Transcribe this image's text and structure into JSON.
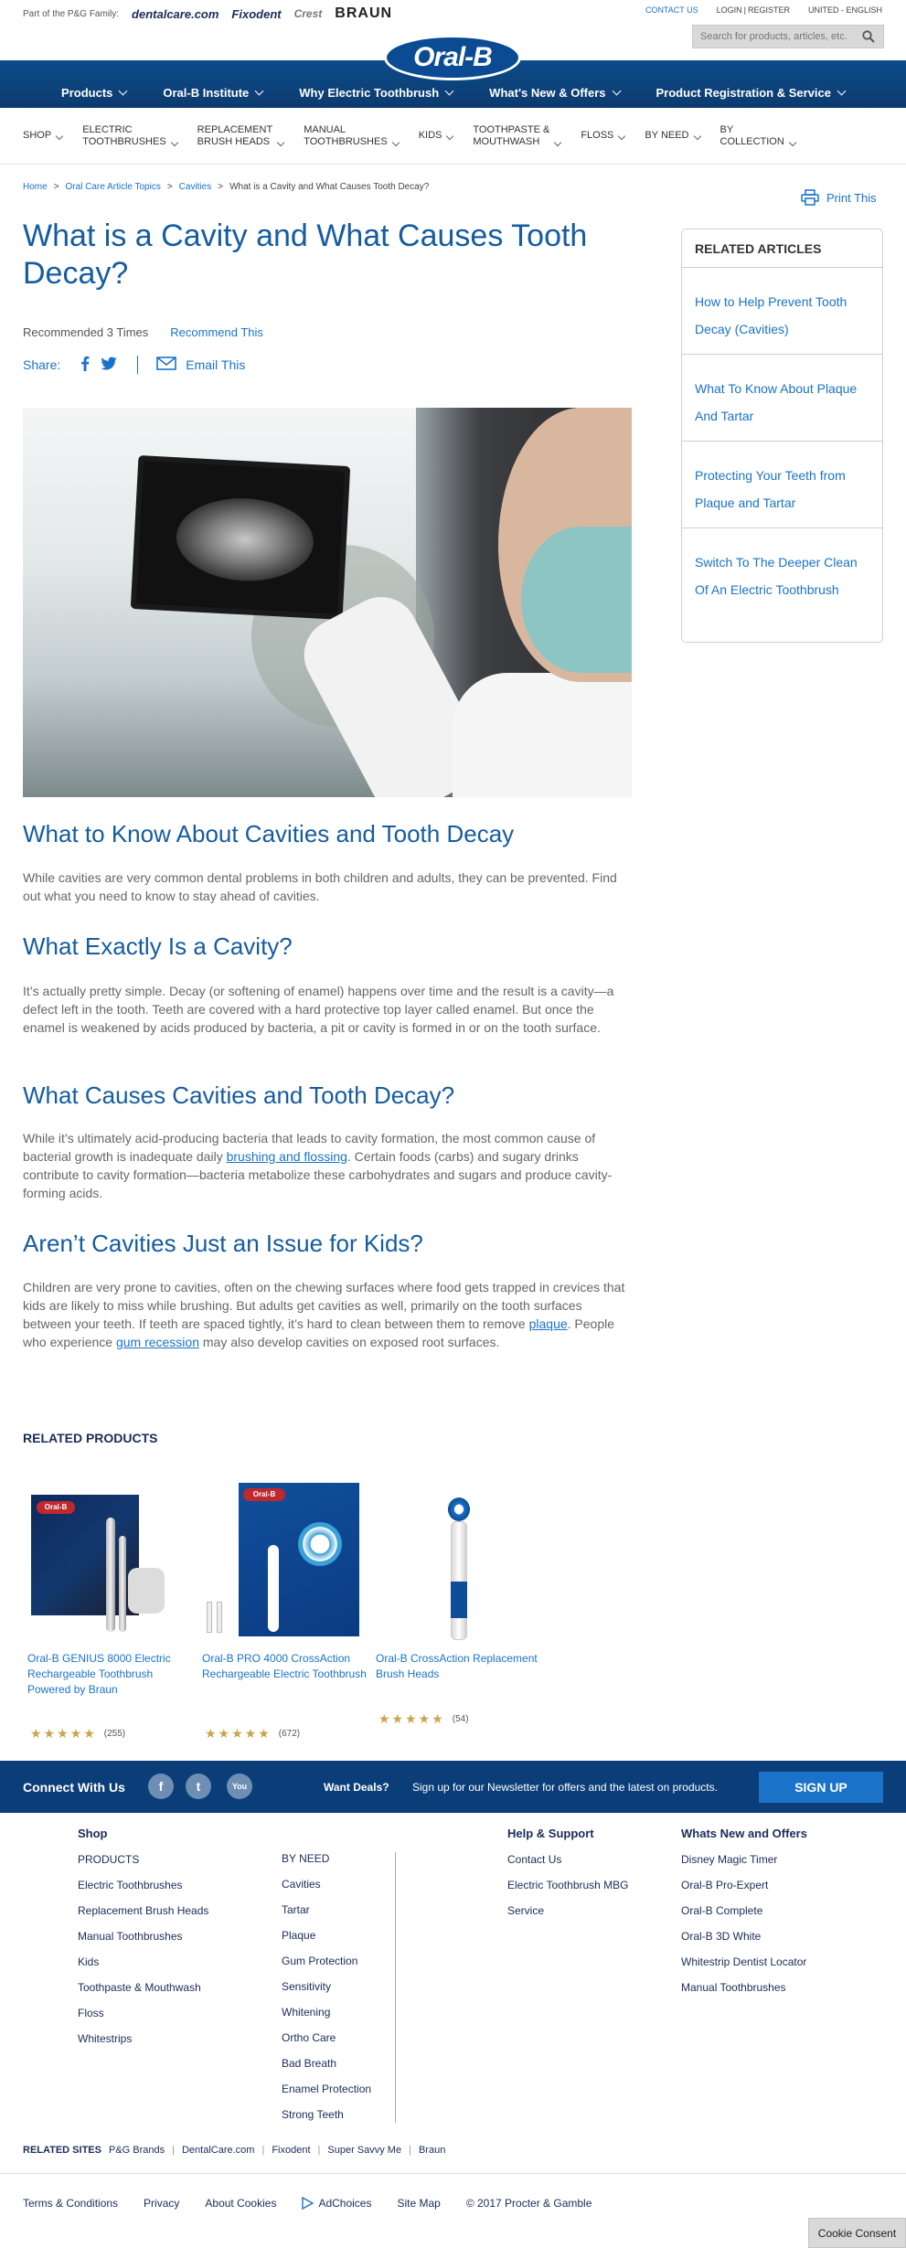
{
  "topbar": {
    "family_label": "Part of the P&G Family:",
    "brands": [
      "dentalcare.com",
      "Fixodent",
      "Crest",
      "BRAUN"
    ],
    "links": [
      "CONTACT US",
      "LOGIN",
      "REGISTER",
      "UNITED - ENGLISH"
    ],
    "search_placeholder": "Search for products, articles, etc."
  },
  "header": {
    "logo_text": "Oral-B",
    "nav": [
      "Products",
      "Oral-B Institute",
      "Why Electric Toothbrush",
      "What's New & Offers",
      "Product Registration & Service"
    ]
  },
  "subnav": [
    {
      "line1": "SHOP",
      "line2": ""
    },
    {
      "line1": "ELECTRIC",
      "line2": "TOOTHBRUSHES"
    },
    {
      "line1": "REPLACEMENT",
      "line2": "BRUSH HEADS"
    },
    {
      "line1": "MANUAL",
      "line2": "TOOTHBRUSHES"
    },
    {
      "line1": "KIDS",
      "line2": ""
    },
    {
      "line1": "TOOTHPASTE &",
      "line2": "MOUTHWASH"
    },
    {
      "line1": "FLOSS",
      "line2": ""
    },
    {
      "line1": "BY NEED",
      "line2": ""
    },
    {
      "line1": "BY",
      "line2": "COLLECTION"
    }
  ],
  "breadcrumb": [
    "Home",
    "Oral Care Article Topics",
    "Cavities",
    "What is a Cavity and What Causes Tooth Decay?"
  ],
  "print_label": "Print This",
  "article": {
    "title": "What is a Cavity and What Causes Tooth Decay?",
    "recommended": "Recommended 3 Times",
    "recommend_link": "Recommend This",
    "share_label": "Share:",
    "email_label": "Email This",
    "sections": [
      {
        "heading": "What to Know About Cavities and Tooth Decay",
        "body": "While cavities are very common dental problems in both children and adults, they can be prevented. Find out what you need to know to stay ahead of cavities."
      },
      {
        "heading": "What Exactly Is a Cavity?",
        "body": "It’s actually pretty simple. Decay (or softening of enamel) happens over time and the result is a cavity—a defect left in the tooth. Teeth are covered with a hard protective top layer called enamel. But once the enamel is weakened by acids produced by bacteria, a pit or cavity is formed in or on the tooth surface."
      },
      {
        "heading": "What Causes Cavities and Tooth Decay?",
        "body_a": "While it’s ultimately acid-producing bacteria that leads to cavity formation, the most common cause of bacterial growth is inadequate daily ",
        "link": "brushing and flossing",
        "body_b": ". Certain foods (carbs) and sugary drinks contribute to cavity formation—bacteria metabolize these carbohydrates and sugars and produce cavity-forming acids."
      },
      {
        "heading": "Aren’t Cavities Just an Issue for Kids?",
        "body_a": "Children are very prone to cavities, often on the chewing surfaces where food gets trapped in crevices that kids are likely to miss while brushing. But adults get cavities as well, primarily on the tooth surfaces between your teeth. If teeth are spaced tightly, it’s hard to clean between them to remove ",
        "link1": "plaque",
        "body_b": ". People who experience ",
        "link2": "gum recession",
        "body_c": " may also develop cavities on exposed root surfaces."
      }
    ]
  },
  "related_articles": {
    "heading": "RELATED ARTICLES",
    "items": [
      "How to Help Prevent Tooth Decay (Cavities)",
      "What To Know About Plaque And Tartar",
      "Protecting Your Teeth from Plaque and Tartar",
      "Switch To The Deeper Clean Of An Electric Toothbrush"
    ]
  },
  "related_products": {
    "heading": "RELATED PRODUCTS",
    "items": [
      {
        "name": "Oral-B GENIUS 8000 Electric Rechargeable Toothbrush Powered by Braun",
        "stars": "★★★★★",
        "count": "(255)",
        "rating": 5
      },
      {
        "name": "Oral-B PRO 4000 CrossAction Rechargeable Electric Toothbrush",
        "stars": "★★★★★",
        "count": "(672)",
        "rating": 5
      },
      {
        "name": "Oral-B CrossAction Replacement Brush Heads",
        "stars": "★★★★★",
        "count": "(54)",
        "rating": 5
      }
    ]
  },
  "connect": {
    "label": "Connect With Us",
    "social": [
      "f",
      "t",
      "You"
    ],
    "deals": "Want Deals?",
    "newsletter": "Sign up for our Newsletter for offers and the latest on products.",
    "signup": "SIGN UP"
  },
  "footer": {
    "shop": {
      "heading": "Shop",
      "links": [
        "PRODUCTS",
        "Electric Toothbrushes",
        "Replacement Brush Heads",
        "Manual Toothbrushes",
        "Kids",
        "Toothpaste & Mouthwash",
        "Floss",
        "Whitestrips"
      ]
    },
    "byneed": {
      "links": [
        "BY NEED",
        "Cavities",
        "Tartar",
        "Plaque",
        "Gum Protection",
        "Sensitivity",
        "Whitening",
        "Ortho Care",
        "Bad Breath",
        "Enamel Protection",
        "Strong Teeth"
      ]
    },
    "help": {
      "heading": "Help & Support",
      "links": [
        "Contact Us",
        "Electric Toothbrush MBG",
        "Service"
      ]
    },
    "whatsnew": {
      "heading": "Whats New and Offers",
      "links": [
        "Disney Magic Timer",
        "Oral-B Pro-Expert",
        "Oral-B Complete",
        "Oral-B 3D White",
        "Whitestrip Dentist Locator",
        "Manual Toothbrushes"
      ]
    },
    "related_sites": {
      "heading": "RELATED SITES",
      "links": [
        "P&G Brands",
        "DentalCare.com",
        "Fixodent",
        "Super Savvy Me",
        "Braun"
      ]
    },
    "legal": [
      "Terms & Conditions",
      "Privacy",
      "About Cookies",
      "AdChoices",
      "Site Map",
      "© 2017 Procter & Gamble"
    ]
  },
  "cookie_button": "Cookie Consent",
  "colors": {
    "brand_blue": "#0b3e78",
    "link": "#1a73c8",
    "heading": "#165ca0",
    "star": "#caa44a"
  }
}
